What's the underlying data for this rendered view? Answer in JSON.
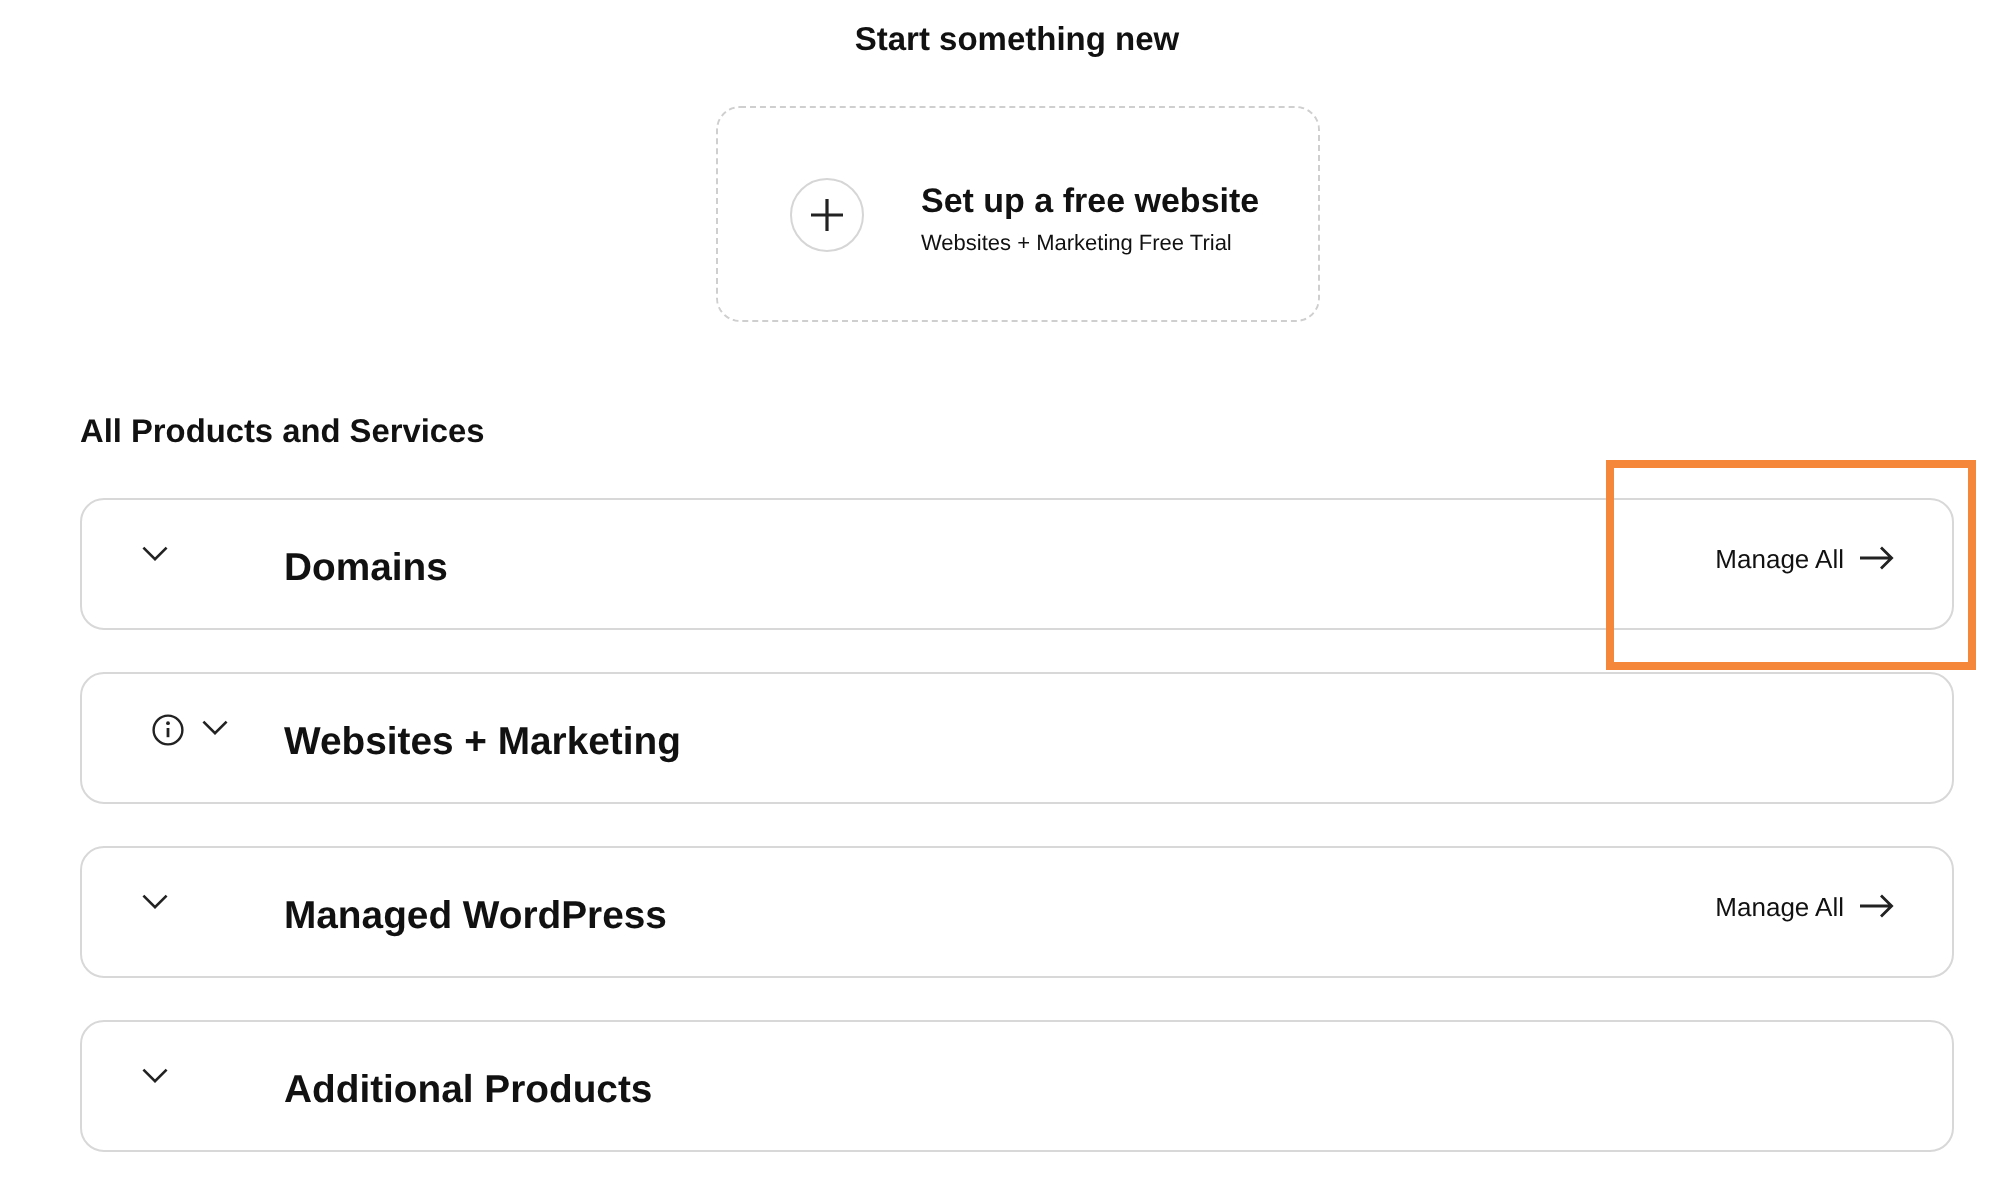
{
  "start_section": {
    "title": "Start something new",
    "card": {
      "title": "Set up a free website",
      "subtitle": "Websites + Marketing Free Trial"
    }
  },
  "products_section": {
    "title": "All Products and Services"
  },
  "products": [
    {
      "name": "Domains",
      "info": false,
      "expanded": false,
      "action": "Manage All",
      "highlighted": true
    },
    {
      "name": "Websites + Marketing",
      "info": true,
      "expanded": false,
      "highlighted": false
    },
    {
      "name": "Managed WordPress",
      "info": false,
      "expanded": false,
      "action": "Manage All",
      "highlighted": false
    },
    {
      "name": "Additional Products",
      "info": false,
      "expanded": false,
      "highlighted": false
    }
  ]
}
